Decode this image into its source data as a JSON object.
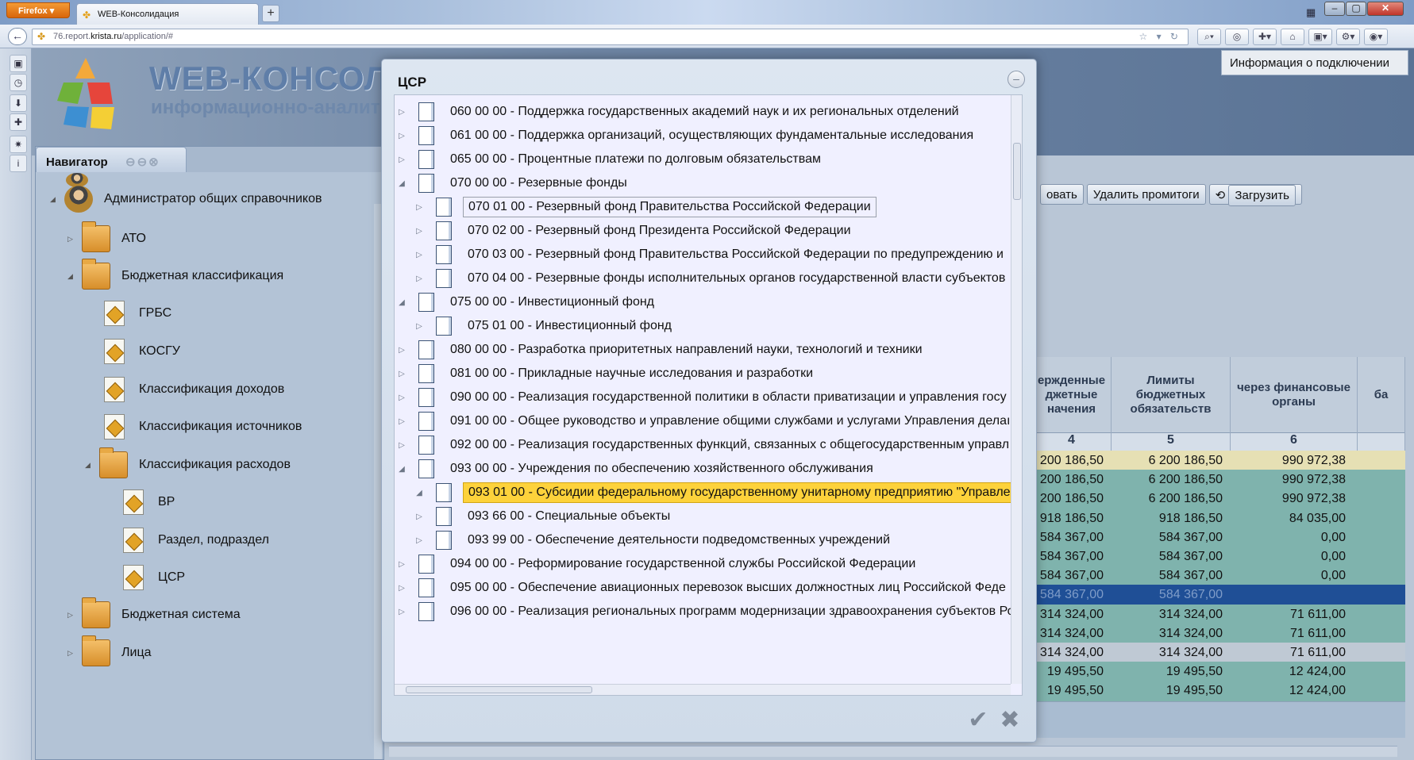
{
  "browser": {
    "menu_label": "Firefox",
    "tab_title": "WEB-Консолидация",
    "new_tab": "+",
    "url_prefix": "76.report.",
    "url_domain": "krista.ru",
    "url_path": "/application/#"
  },
  "app": {
    "title": "WEB-КОНСОЛИДА",
    "subtitle": "информационно-аналитич",
    "connection_info": "Информация о подключении"
  },
  "navigator": {
    "title": "Навигатор",
    "items": [
      {
        "label": "Администратор общих справочников"
      },
      {
        "label": "АТО"
      },
      {
        "label": "Бюджетная классификация"
      },
      {
        "label": "ГРБС"
      },
      {
        "label": "КОСГУ"
      },
      {
        "label": "Классификация доходов"
      },
      {
        "label": "Классификация источников"
      },
      {
        "label": "Классификация расходов"
      },
      {
        "label": "ВР"
      },
      {
        "label": "Раздел, подраздел"
      },
      {
        "label": "ЦСР"
      },
      {
        "label": "Бюджетная система"
      },
      {
        "label": "Лица"
      }
    ]
  },
  "grid": {
    "toolbar": [
      "овать",
      "Удалить промитоги",
      "Загрузить"
    ],
    "headers": [
      {
        "label": "ержденные джетные начения",
        "num": "4"
      },
      {
        "label": "Лимиты бюджетных обязательств",
        "num": "5"
      },
      {
        "label": "через финансовые органы",
        "num": "6"
      },
      {
        "label": "ба",
        "num": ""
      }
    ],
    "rows": [
      [
        "200 186,50",
        "6 200 186,50",
        "990 972,38"
      ],
      [
        "200 186,50",
        "6 200 186,50",
        "990 972,38"
      ],
      [
        "200 186,50",
        "6 200 186,50",
        "990 972,38"
      ],
      [
        "918 186,50",
        "918 186,50",
        "84 035,00"
      ],
      [
        "584 367,00",
        "584 367,00",
        "0,00"
      ],
      [
        "584 367,00",
        "584 367,00",
        "0,00"
      ],
      [
        "584 367,00",
        "584 367,00",
        "0,00"
      ],
      [
        "584 367,00",
        "584 367,00",
        ""
      ],
      [
        "314 324,00",
        "314 324,00",
        "71 611,00"
      ],
      [
        "314 324,00",
        "314 324,00",
        "71 611,00"
      ],
      [
        "314 324,00",
        "314 324,00",
        "71 611,00"
      ],
      [
        "19 495,50",
        "19 495,50",
        "12 424,00"
      ],
      [
        "19 495,50",
        "19 495,50",
        "12 424,00"
      ]
    ],
    "row_colors": [
      "#e6e0b4",
      "#7fb3ad",
      "#7fb3ad",
      "#7fb3ad",
      "#7fb3ad",
      "#7fb3ad",
      "#7fb3ad",
      "#1f4f96",
      "#7fb3ad",
      "#7fb3ad",
      "#bfc9d4",
      "#7fb3ad",
      "#7fb3ad"
    ]
  },
  "dialog": {
    "title": "ЦСР",
    "tree": [
      {
        "label": "060 00 00 - Поддержка государственных академий наук и их региональных отделений",
        "level": 0,
        "state": "collapsed"
      },
      {
        "label": "061 00 00 - Поддержка организаций, осуществляющих фундаментальные исследования",
        "level": 0,
        "state": "collapsed"
      },
      {
        "label": "065 00 00 - Процентные платежи по долговым обязательствам",
        "level": 0,
        "state": "collapsed"
      },
      {
        "label": "070 00 00 - Резервные фонды",
        "level": 0,
        "state": "expanded"
      },
      {
        "label": "070 01 00 - Резервный фонд Правительства Российской Федерации",
        "level": 1,
        "state": "collapsed",
        "focused": true
      },
      {
        "label": "070 02 00 - Резервный фонд Президента Российской Федерации",
        "level": 1,
        "state": "collapsed"
      },
      {
        "label": "070 03 00 - Резервный фонд Правительства Российской Федерации по предупреждению и",
        "level": 1,
        "state": "collapsed"
      },
      {
        "label": "070 04 00 - Резервные фонды исполнительных органов государственной власти субъектов",
        "level": 1,
        "state": "collapsed"
      },
      {
        "label": "075 00 00 - Инвестиционный фонд",
        "level": 0,
        "state": "expanded"
      },
      {
        "label": "075 01 00 - Инвестиционный фонд",
        "level": 1,
        "state": "collapsed"
      },
      {
        "label": "080 00 00 - Разработка приоритетных направлений науки, технологий и техники",
        "level": 0,
        "state": "collapsed"
      },
      {
        "label": "081 00 00 - Прикладные научные исследования и разработки",
        "level": 0,
        "state": "collapsed"
      },
      {
        "label": "090 00 00 - Реализация государственной политики в области приватизации и управления госу",
        "level": 0,
        "state": "collapsed"
      },
      {
        "label": "091 00 00 - Общее руководство и управление общими службами и услугами Управления делаı",
        "level": 0,
        "state": "collapsed"
      },
      {
        "label": "092 00 00 - Реализация государственных функций, связанных с общегосударственным управл",
        "level": 0,
        "state": "collapsed"
      },
      {
        "label": "093 00 00 - Учреждения по обеспечению хозяйственного обслуживания",
        "level": 0,
        "state": "expanded"
      },
      {
        "label": "093 01 00 - Субсидии федеральному государственному унитарному предприятию \"Управле",
        "level": 1,
        "state": "expanded",
        "selected": true
      },
      {
        "label": "093 66 00 - Специальные объекты",
        "level": 1,
        "state": "collapsed"
      },
      {
        "label": "093 99 00 - Обеспечение деятельности подведомственных учреждений",
        "level": 1,
        "state": "collapsed"
      },
      {
        "label": "094 00 00 - Реформирование государственной службы Российской Федерации",
        "level": 0,
        "state": "collapsed"
      },
      {
        "label": "095 00 00 - Обеспечение авиационных перевозок высших должностных лиц Российской Феде",
        "level": 0,
        "state": "collapsed"
      },
      {
        "label": "096 00 00 - Реализация региональных программ модернизации здравоохранения субъектов Ро",
        "level": 0,
        "state": "collapsed"
      }
    ],
    "ok_symbol": "✔",
    "cancel_symbol": "✖"
  },
  "icons": {
    "expanded": "◢",
    "collapsed": "▷"
  }
}
